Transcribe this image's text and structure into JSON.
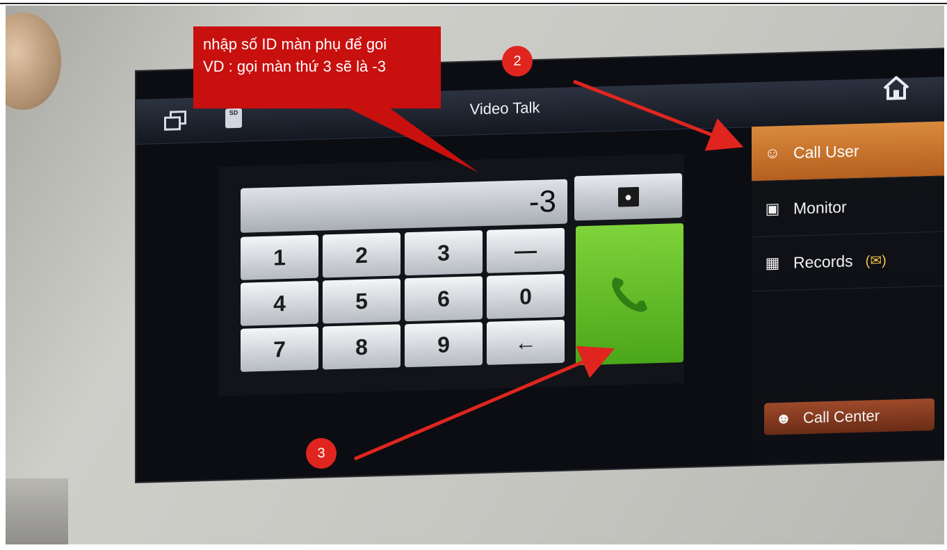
{
  "screen": {
    "title": "Video Talk",
    "sd_label": "SD"
  },
  "sidebar": {
    "items": [
      {
        "label": "Call User",
        "icon": "user-icon",
        "active": true
      },
      {
        "label": "Monitor",
        "icon": "camera-icon"
      },
      {
        "label": "Records",
        "icon": "records-icon",
        "badge": "(✉)"
      }
    ],
    "call_center_label": "Call Center"
  },
  "dialer": {
    "display_value": "-3",
    "keys": [
      "1",
      "2",
      "3",
      "—",
      "4",
      "5",
      "6",
      "0",
      "7",
      "8",
      "9",
      "←"
    ]
  },
  "annotations": {
    "note_line1": "nhập số  ID màn phụ để goi",
    "note_line2": "VD :  gọi màn thứ 3 sẽ là -3",
    "badge_2": "2",
    "badge_3": "3"
  },
  "colors": {
    "accent_orange": "#c8702b",
    "call_green": "#5fbf26",
    "annotation_red": "#c8100f"
  }
}
